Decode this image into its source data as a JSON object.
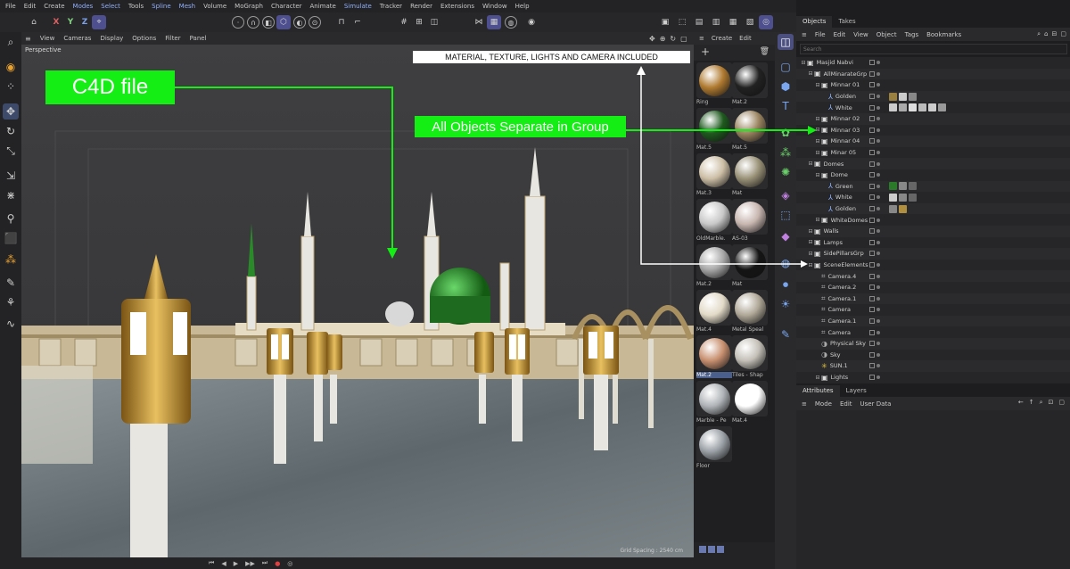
{
  "menubar": [
    "File",
    "Edit",
    "Create",
    "Modes",
    "Select",
    "Tools",
    "Spline",
    "Mesh",
    "Volume",
    "MoGraph",
    "Character",
    "Animate",
    "Simulate",
    "Tracker",
    "Render",
    "Extensions",
    "Window",
    "Help"
  ],
  "menubar_highlight": [
    "Modes",
    "Select",
    "Spline",
    "Mesh",
    "Simulate"
  ],
  "toolbar": {
    "axis_x": "X",
    "axis_y": "Y",
    "axis_z": "Z"
  },
  "viewport": {
    "menu": [
      "View",
      "Cameras",
      "Display",
      "Options",
      "Filter",
      "Panel"
    ],
    "title": "Perspective",
    "grid_spacing": "Grid Spacing : 2540 cm"
  },
  "overlays": {
    "c4d_file": "C4D file",
    "groups": "All Objects Separate in Group",
    "included": "MATERIAL, TEXTURE, LIGHTS AND CAMERA INCLUDED"
  },
  "materials": {
    "menu": [
      "Create",
      "Edit"
    ],
    "items": [
      {
        "name": "Ring",
        "color": "#b07a30"
      },
      {
        "name": "Mat.2",
        "color": "#222222"
      },
      {
        "name": "Mat.5",
        "color": "#1e5a1e"
      },
      {
        "name": "Mat.5",
        "color": "#9a8460"
      },
      {
        "name": "Mat.3",
        "color": "#cdbfa6"
      },
      {
        "name": "Mat",
        "color": "#9a9278"
      },
      {
        "name": "OldMarble.",
        "color": "#c8c8c8"
      },
      {
        "name": "AS-03",
        "color": "#c8b6b0"
      },
      {
        "name": "Mat.2",
        "color": "#a8a8a8"
      },
      {
        "name": "Mat",
        "color": "#151515"
      },
      {
        "name": "Mat.4",
        "color": "#e2dac8"
      },
      {
        "name": "Metal Speal",
        "color": "#b0a898"
      },
      {
        "name": "Mat.2",
        "color": "#c89070"
      },
      {
        "name": "Tiles - Shap",
        "color": "#c4c0b8"
      },
      {
        "name": "Marble - Pe",
        "color": "#b0b4b8"
      },
      {
        "name": "Mat.4",
        "color": "#ffffff"
      },
      {
        "name": "Floor",
        "color": "#9aa0a6"
      }
    ],
    "selected_index": 12
  },
  "objects": {
    "tabs": [
      "Objects",
      "Takes"
    ],
    "menu": [
      "File",
      "Edit",
      "View",
      "Object",
      "Tags",
      "Bookmarks"
    ],
    "search_placeholder": "Search",
    "rows": [
      {
        "label": "Masjid Nabvi",
        "depth": 0,
        "icon": "group"
      },
      {
        "label": "AllMinarateGrp",
        "depth": 1,
        "icon": "group"
      },
      {
        "label": "Minnar 01",
        "depth": 2,
        "icon": "group"
      },
      {
        "label": "Golden",
        "depth": 3,
        "icon": "bone",
        "tags": [
          "#9a8040",
          "#cccccc",
          "#888888"
        ]
      },
      {
        "label": "White",
        "depth": 3,
        "icon": "bone",
        "tags": [
          "#cccccc",
          "#aaaaaa",
          "#dddddd",
          "#bbbbbb",
          "#cccccc",
          "#999999"
        ]
      },
      {
        "label": "Minnar 02",
        "depth": 2,
        "icon": "group"
      },
      {
        "label": "Minnar 03",
        "depth": 2,
        "icon": "group"
      },
      {
        "label": "Minnar 04",
        "depth": 2,
        "icon": "group"
      },
      {
        "label": "Minar 05",
        "depth": 2,
        "icon": "group"
      },
      {
        "label": "Domes",
        "depth": 1,
        "icon": "group"
      },
      {
        "label": "Dome",
        "depth": 2,
        "icon": "group"
      },
      {
        "label": "Green",
        "depth": 3,
        "icon": "bone",
        "tags": [
          "#2a7a2a",
          "#888888",
          "#666666"
        ]
      },
      {
        "label": "White",
        "depth": 3,
        "icon": "bone",
        "tags": [
          "#cccccc",
          "#888888",
          "#666666"
        ]
      },
      {
        "label": "Golden",
        "depth": 3,
        "icon": "bone",
        "tags": [
          "#888888",
          "#b09040"
        ]
      },
      {
        "label": "WhiteDomes",
        "depth": 2,
        "icon": "group"
      },
      {
        "label": "Walls",
        "depth": 1,
        "icon": "group"
      },
      {
        "label": "Lamps",
        "depth": 1,
        "icon": "group"
      },
      {
        "label": "SidePillarsGrp",
        "depth": 1,
        "icon": "group"
      },
      {
        "label": "SceneElements",
        "depth": 1,
        "icon": "group"
      },
      {
        "label": "Camera.4",
        "depth": 2,
        "icon": "cam"
      },
      {
        "label": "Camera.2",
        "depth": 2,
        "icon": "cam"
      },
      {
        "label": "Camera.1",
        "depth": 2,
        "icon": "cam"
      },
      {
        "label": "Camera",
        "depth": 2,
        "icon": "cam"
      },
      {
        "label": "Camera.1",
        "depth": 2,
        "icon": "cam"
      },
      {
        "label": "Camera",
        "depth": 2,
        "icon": "cam"
      },
      {
        "label": "Physical Sky",
        "depth": 2,
        "icon": "sky"
      },
      {
        "label": "Sky",
        "depth": 2,
        "icon": "sky"
      },
      {
        "label": "SUN.1",
        "depth": 2,
        "icon": "light"
      },
      {
        "label": "Lights",
        "depth": 2,
        "icon": "group"
      }
    ]
  },
  "attributes": {
    "tabs": [
      "Attributes",
      "Layers"
    ],
    "menu": [
      "Mode",
      "Edit",
      "User Data"
    ]
  }
}
